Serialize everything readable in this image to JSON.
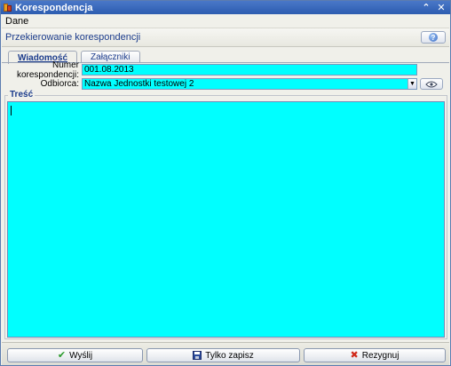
{
  "window": {
    "title": "Korespondencja"
  },
  "menu": {
    "items": [
      {
        "label": "Dane"
      }
    ]
  },
  "header": {
    "title": "Przekierowanie korespondencji",
    "help_icon": "?"
  },
  "tabs": [
    {
      "label": "Wiadomość",
      "active": true
    },
    {
      "label": "Załączniki",
      "active": false
    }
  ],
  "form": {
    "number_label": "Numer korespondencji:",
    "number_value": "001.08.2013",
    "recipient_label": "Odbiorca:",
    "recipient_value": "Nazwa Jednostki testowej 2"
  },
  "content": {
    "legend": "Treść",
    "value": ""
  },
  "footer": {
    "send_label": "Wyślij",
    "save_label": "Tylko zapisz",
    "cancel_label": "Rezygnuj"
  },
  "colors": {
    "input_bg": "#00ffff",
    "title_bar": "#2c5cb0",
    "accent_text": "#1c3c8c"
  }
}
